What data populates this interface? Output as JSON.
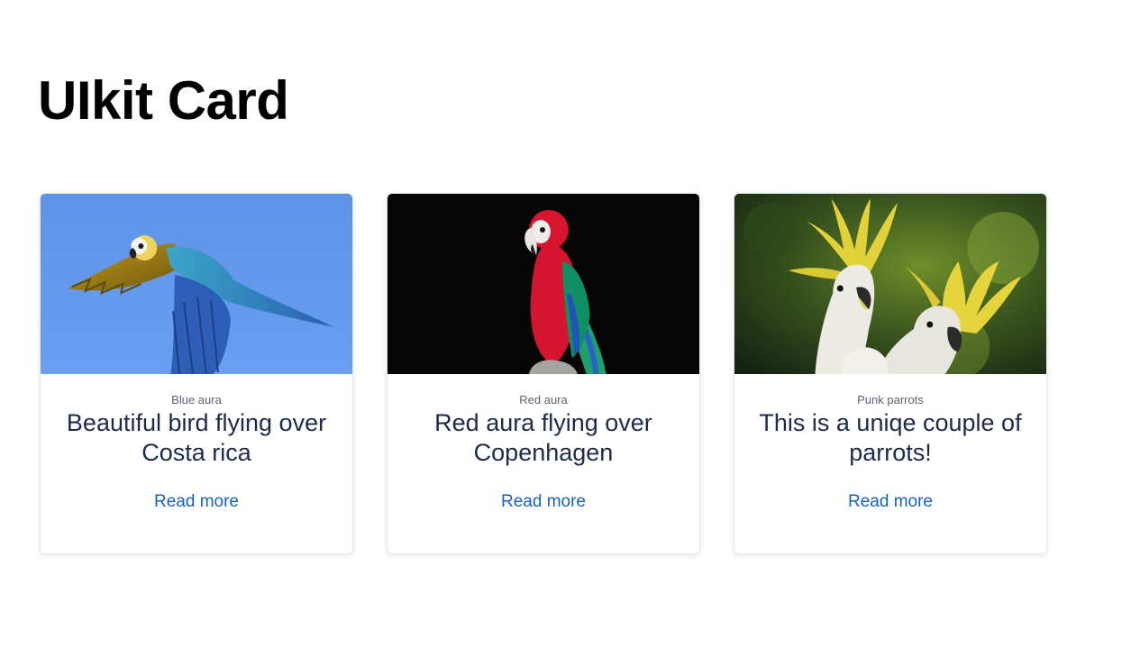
{
  "page": {
    "title": "UIkit Card"
  },
  "cards": [
    {
      "meta": "Blue aura",
      "title": "Beautiful bird flying over Costa rica",
      "link_label": "Read more",
      "image_name": "blue-macaw-flying-image"
    },
    {
      "meta": "Red aura",
      "title": "Red aura flying over Copenhagen",
      "link_label": "Read more",
      "image_name": "red-macaw-perched-image"
    },
    {
      "meta": "Punk parrots",
      "title": "This is a uniqe couple of parrots!",
      "link_label": "Read more",
      "image_name": "cockatoo-couple-image"
    }
  ],
  "colors": {
    "title": "#000000",
    "card_title": "#1c2b4a",
    "meta": "#5b6472",
    "link": "#1561c2",
    "card_border": "#e6e8eb"
  }
}
